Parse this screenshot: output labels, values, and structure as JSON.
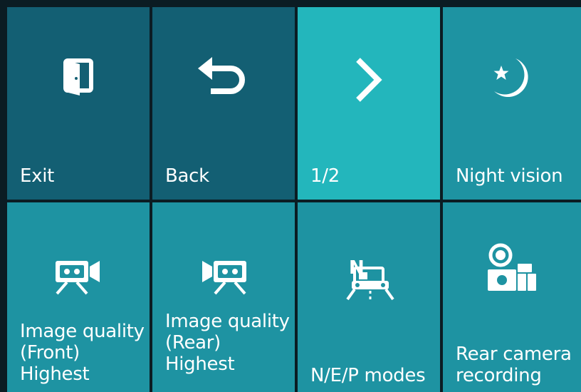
{
  "menu": {
    "exit": {
      "label": "Exit",
      "icon": "exit-door-icon"
    },
    "back": {
      "label": "Back",
      "icon": "back-arrow-icon"
    },
    "page": {
      "label": "1/2",
      "icon": "chevron-right-icon"
    },
    "night_vision": {
      "label": "Night vision",
      "icon": "moon-star-icon"
    },
    "image_quality_front": {
      "line1": "Image quality",
      "line2": "(Front)",
      "line3": "Highest",
      "icon": "front-camera-icon"
    },
    "image_quality_rear": {
      "line1": "Image quality",
      "line2": "(Rear)",
      "line3": "Highest",
      "icon": "rear-camera-icon"
    },
    "modes": {
      "label": "N/E/P modes",
      "icon": "parking-car-icon"
    },
    "rear_camera_recording": {
      "line1": "Rear camera",
      "line2": "recording",
      "icon": "rear-camera-recording-icon"
    }
  },
  "colors": {
    "dark_tile": "#135f73",
    "highlight_tile": "#23b6bc",
    "tile": "#1e93a2",
    "grid_background": "#0b1c23",
    "text": "#ffffff"
  }
}
